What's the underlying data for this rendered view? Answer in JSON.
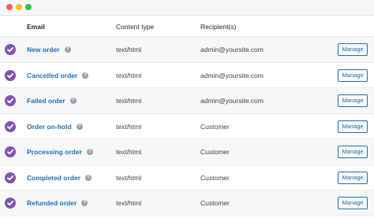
{
  "window": {
    "controls": [
      "close",
      "minimize",
      "maximize"
    ]
  },
  "table": {
    "columns": {
      "email": "Email",
      "content_type": "Content type",
      "recipients": "Recipient(s)"
    },
    "rows": [
      {
        "enabled": true,
        "email": "New order",
        "content_type": "text/html",
        "recipients": "admin@yoursite.com",
        "action": "Manage"
      },
      {
        "enabled": true,
        "email": "Cancelled order",
        "content_type": "text/html",
        "recipients": "admin@yoursite.com",
        "action": "Manage"
      },
      {
        "enabled": true,
        "email": "Failed order",
        "content_type": "text/html",
        "recipients": "admin@yoursite.com",
        "action": "Manage"
      },
      {
        "enabled": true,
        "email": "Order on-hold",
        "content_type": "text/html",
        "recipients": "Customer",
        "action": "Manage"
      },
      {
        "enabled": true,
        "email": "Processing order",
        "content_type": "text/html",
        "recipients": "Customer",
        "action": "Manage"
      },
      {
        "enabled": true,
        "email": "Completed order",
        "content_type": "text/html",
        "recipients": "Customer",
        "action": "Manage"
      },
      {
        "enabled": true,
        "email": "Refunded order",
        "content_type": "text/html",
        "recipients": "Customer",
        "action": "Manage"
      }
    ]
  },
  "colors": {
    "check": "#7f54b3",
    "link": "#2271b1",
    "row_alt": "#f6f7f7"
  },
  "icons": {
    "status": "check-circle-icon",
    "help": "help-question-icon"
  }
}
